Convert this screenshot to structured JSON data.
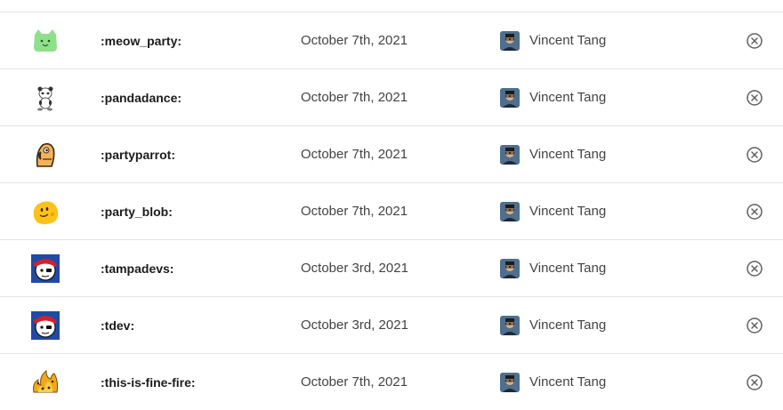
{
  "emoji_rows": [
    {
      "emoji_icon": "meow-party-icon",
      "name": ":meow_party:",
      "date": "October 7th, 2021",
      "author": "Vincent Tang"
    },
    {
      "emoji_icon": "pandadance-icon",
      "name": ":pandadance:",
      "date": "October 7th, 2021",
      "author": "Vincent Tang"
    },
    {
      "emoji_icon": "partyparrot-icon",
      "name": ":partyparrot:",
      "date": "October 7th, 2021",
      "author": "Vincent Tang"
    },
    {
      "emoji_icon": "party-blob-icon",
      "name": ":party_blob:",
      "date": "October 7th, 2021",
      "author": "Vincent Tang"
    },
    {
      "emoji_icon": "tampadevs-icon",
      "name": ":tampadevs:",
      "date": "October 3rd, 2021",
      "author": "Vincent Tang"
    },
    {
      "emoji_icon": "tdev-icon",
      "name": ":tdev:",
      "date": "October 3rd, 2021",
      "author": "Vincent Tang"
    },
    {
      "emoji_icon": "this-is-fine-fire-icon",
      "name": ":this-is-fine-fire:",
      "date": "October 7th, 2021",
      "author": "Vincent Tang"
    }
  ],
  "colors": {
    "divider": "#e4e4e4",
    "name_text": "#1d1c1d",
    "secondary_text": "#454245",
    "remove_icon": "#616061"
  },
  "icons": {
    "remove": "remove-circle-x-icon",
    "avatar": "user-avatar"
  }
}
